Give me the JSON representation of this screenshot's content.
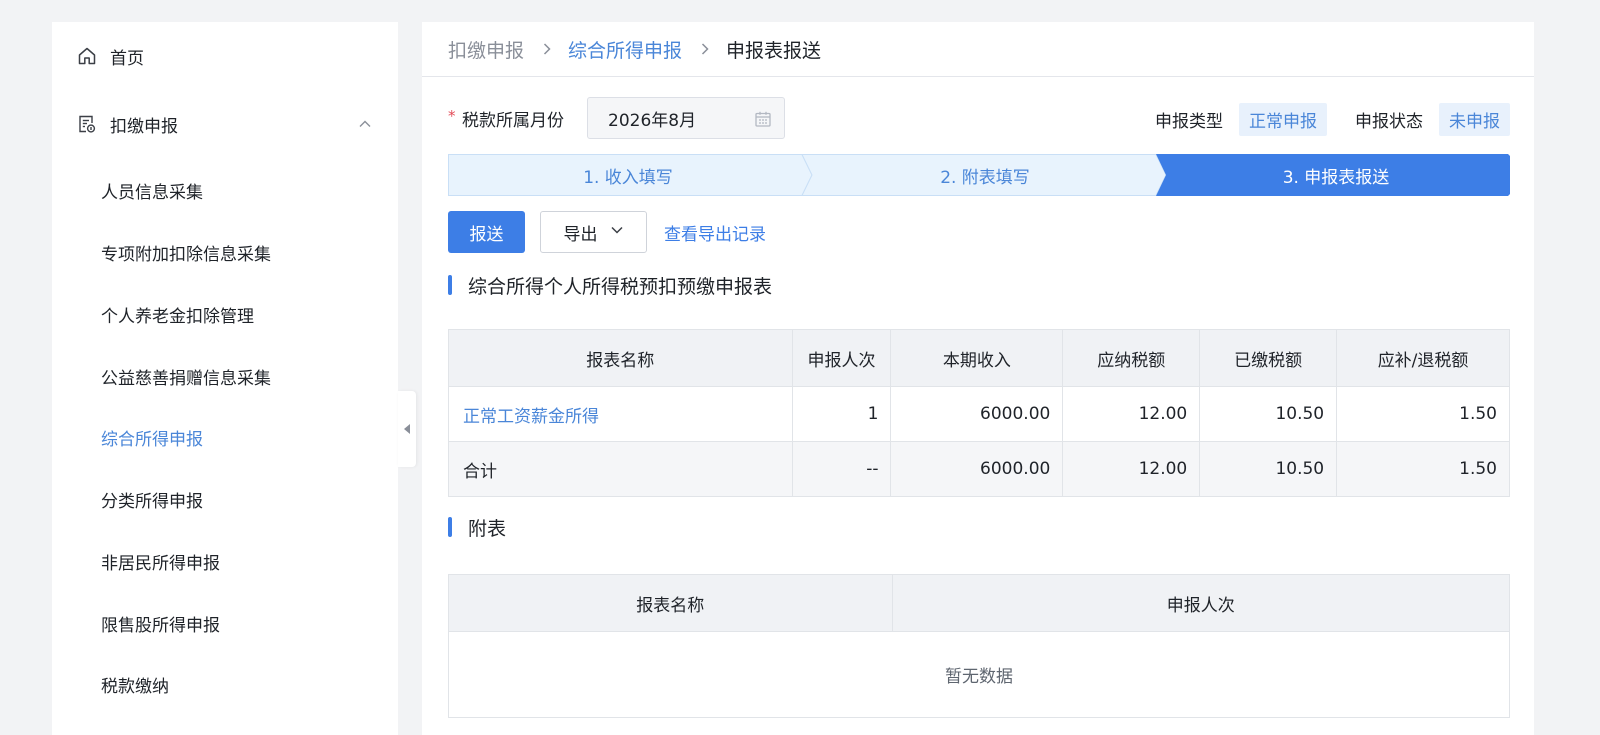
{
  "sidebar": {
    "home_label": "首页",
    "group_label": "扣缴申报",
    "items": [
      {
        "label": "人员信息采集",
        "active": false
      },
      {
        "label": "专项附加扣除信息采集",
        "active": false
      },
      {
        "label": "个人养老金扣除管理",
        "active": false
      },
      {
        "label": "公益慈善捐赠信息采集",
        "active": false
      },
      {
        "label": "综合所得申报",
        "active": true
      },
      {
        "label": "分类所得申报",
        "active": false
      },
      {
        "label": "非居民所得申报",
        "active": false
      },
      {
        "label": "限售股所得申报",
        "active": false
      },
      {
        "label": "税款缴纳",
        "active": false
      }
    ]
  },
  "breadcrumb": [
    "扣缴申报",
    "综合所得申报",
    "申报表报送"
  ],
  "form": {
    "required_mark": "*",
    "month_label": "税款所属月份",
    "month_value": "2026年8月",
    "type_label": "申报类型",
    "type_value": "正常申报",
    "status_label": "申报状态",
    "status_value": "未申报"
  },
  "steps": [
    "1. 收入填写",
    "2. 附表填写",
    "3. 申报表报送"
  ],
  "actions": {
    "submit": "报送",
    "export": "导出",
    "history": "查看导出记录"
  },
  "main_table": {
    "title": "综合所得个人所得税预扣预缴申报表",
    "headers": [
      "报表名称",
      "申报人次",
      "本期收入",
      "应纳税额",
      "已缴税额",
      "应补/退税额"
    ],
    "row": [
      "正常工资薪金所得",
      "1",
      "6000.00",
      "12.00",
      "10.50",
      "1.50"
    ],
    "total": [
      "合计",
      "--",
      "6000.00",
      "12.00",
      "10.50",
      "1.50"
    ]
  },
  "attachment_table": {
    "title": "附表",
    "headers": [
      "报表名称",
      "申报人次"
    ],
    "empty_text": "暂无数据"
  },
  "colors": {
    "accent": "#3d7ee6",
    "step_inactive_bg": "#e8f3fd",
    "step_inactive_text": "#4a86d8"
  }
}
